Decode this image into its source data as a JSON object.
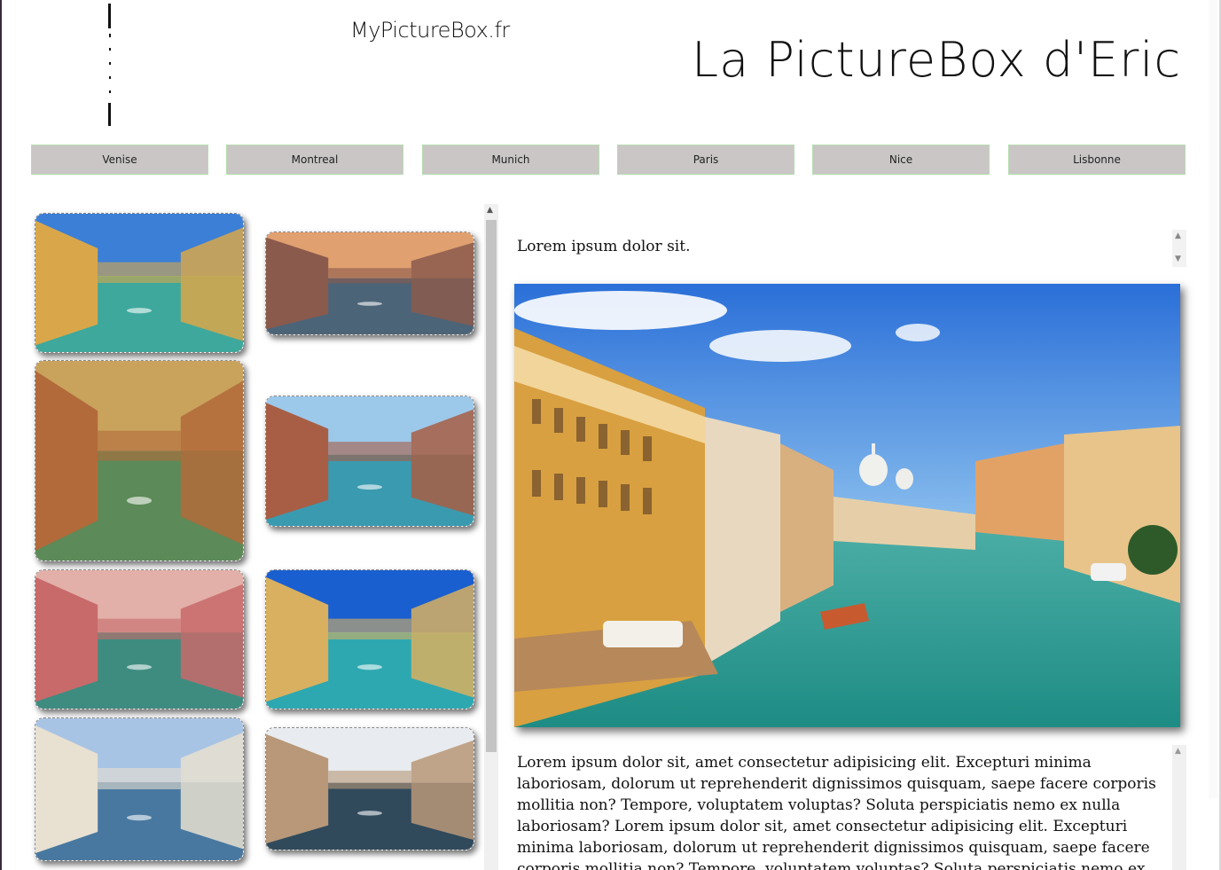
{
  "header": {
    "site_name": "MyPictureBox.fr",
    "title": "La PictureBox d'Eric",
    "logo_icon": "bar-logo-icon"
  },
  "nav": {
    "items": [
      {
        "label": "Venise"
      },
      {
        "label": "Montreal"
      },
      {
        "label": "Munich"
      },
      {
        "label": "Paris"
      },
      {
        "label": "Nice"
      },
      {
        "label": "Lisbonne"
      }
    ]
  },
  "gallery": {
    "thumbnails": [
      {
        "name": "grand-canal-daylight",
        "sky": "#3b7fd6",
        "water": "#3ea89c",
        "building": "#d9a74a"
      },
      {
        "name": "canal-sunset",
        "sky": "#e0a070",
        "water": "#4c6478",
        "building": "#8a5a4c"
      },
      {
        "name": "narrow-canal-bridge",
        "sky": "#c9a25c",
        "water": "#5c8a58",
        "building": "#b26a3a"
      },
      {
        "name": "bridge-of-sighs",
        "sky": "#9cc8ea",
        "water": "#3a9ab0",
        "building": "#a85e44"
      },
      {
        "name": "gondola-canal",
        "sky": "#e2b0a8",
        "water": "#3e8c80",
        "building": "#c86a6a"
      },
      {
        "name": "grand-canal-blue",
        "sky": "#1a5fcf",
        "water": "#2ea8b0",
        "building": "#d8b060"
      },
      {
        "name": "rialto-gondola",
        "sky": "#a8c4e4",
        "water": "#4878a0",
        "building": "#e8e0d0"
      },
      {
        "name": "salute-dusk",
        "sky": "#e8ecf0",
        "water": "#304a5c",
        "building": "#b89878"
      }
    ]
  },
  "viewer": {
    "caption": "Lorem ipsum dolor sit.",
    "image_name": "grand-canal-main",
    "description": "Lorem ipsum dolor sit, amet consectetur adipisicing elit. Excepturi minima laboriosam, dolorum ut reprehenderit dignissimos quisquam, saepe facere corporis mollitia non? Tempore, voluptatem voluptas? Soluta perspiciatis nemo ex nulla laboriosam? Lorem ipsum dolor sit, amet consectetur adipisicing elit. Excepturi minima laboriosam, dolorum ut reprehenderit dignissimos quisquam, saepe facere corporis mollitia non? Tempore, voluptatem voluptas? Soluta perspiciatis nemo ex nulla laboriosam?"
  },
  "colors": {
    "nav_bg": "#cac6c6",
    "nav_border": "#b6dcb0"
  }
}
